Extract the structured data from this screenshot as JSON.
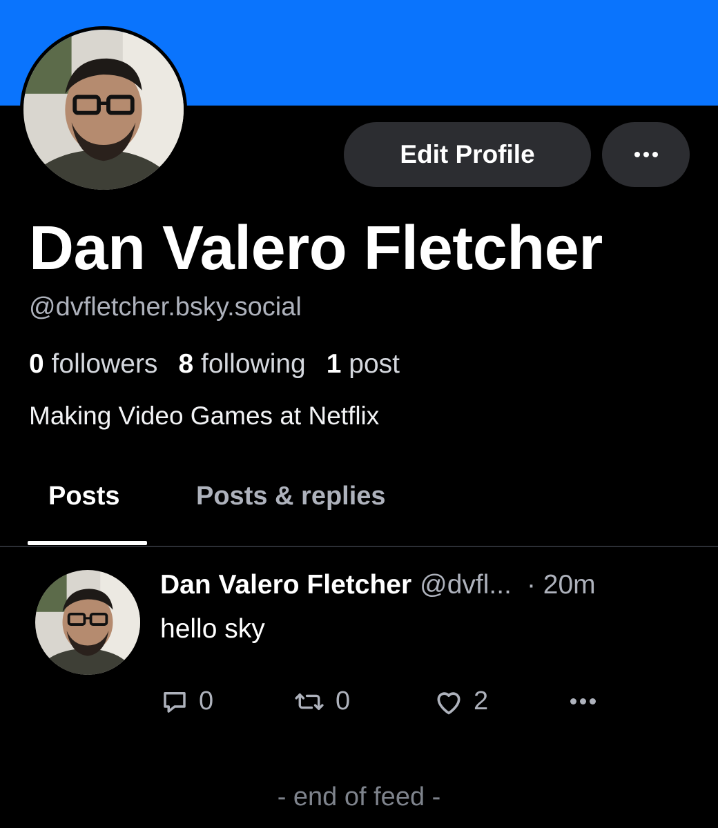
{
  "profile": {
    "display_name": "Dan Valero Fletcher",
    "handle": "@dvfletcher.bsky.social",
    "followers_count": "0",
    "followers_label": "followers",
    "following_count": "8",
    "following_label": "following",
    "posts_count": "1",
    "posts_label": "post",
    "bio": "Making Video Games at Netflix",
    "banner_color": "#0a74fd"
  },
  "actions": {
    "edit_profile_label": "Edit Profile",
    "more_icon": "ellipsis-icon"
  },
  "tabs": [
    {
      "label": "Posts",
      "selected": true
    },
    {
      "label": "Posts & replies",
      "selected": false
    }
  ],
  "feed": {
    "posts": [
      {
        "author": "Dan Valero Fletcher",
        "handle": "@dvfl...",
        "time": "· 20m",
        "text": "hello sky",
        "replies": "0",
        "reposts": "0",
        "likes": "2"
      }
    ],
    "end_label": "- end of feed -"
  }
}
